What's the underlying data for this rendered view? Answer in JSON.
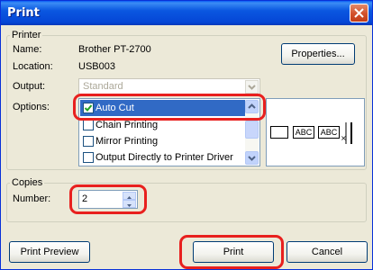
{
  "window": {
    "title": "Print"
  },
  "printer_group": {
    "legend": "Printer",
    "name_label": "Name:",
    "name_value": "Brother PT-2700",
    "location_label": "Location:",
    "location_value": "USB003",
    "properties_button": "Properties...",
    "output_label": "Output:",
    "output_value": "Standard",
    "options_label": "Options:",
    "options": [
      {
        "label": "Auto Cut",
        "checked": true,
        "selected": true
      },
      {
        "label": "Chain Printing",
        "checked": false,
        "selected": false
      },
      {
        "label": "Mirror Printing",
        "checked": false,
        "selected": false
      },
      {
        "label": "Output Directly to Printer Driver",
        "checked": false,
        "selected": false
      }
    ],
    "preview_tags": [
      "ABC",
      "ABC"
    ]
  },
  "copies_group": {
    "legend": "Copies",
    "number_label": "Number:",
    "number_value": "2"
  },
  "footer": {
    "print_preview": "Print Preview",
    "print": "Print",
    "cancel": "Cancel"
  },
  "colors": {
    "titlebar": "#0a5df3",
    "selection": "#316ac5",
    "highlight": "#e8201e"
  }
}
